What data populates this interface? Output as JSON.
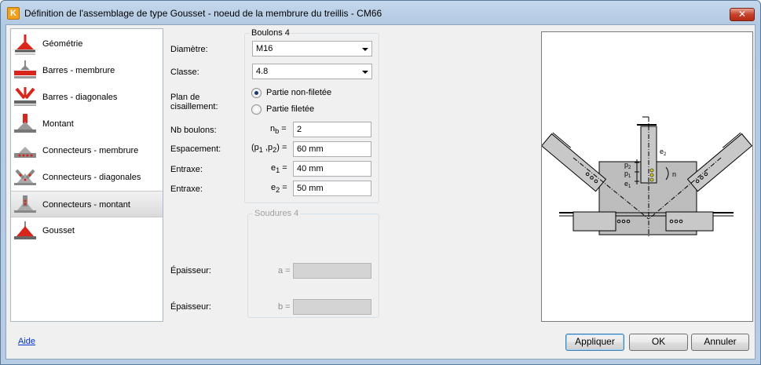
{
  "window": {
    "title": "Définition de l'assemblage de type Gousset - noeud de la membrure du treillis - CM66",
    "close_glyph": "✕",
    "app_icon_glyph": "K"
  },
  "nav": {
    "items": [
      {
        "label": "Géométrie",
        "icon": "geometry-icon"
      },
      {
        "label": "Barres - membrure",
        "icon": "chord-bars-icon"
      },
      {
        "label": "Barres - diagonales",
        "icon": "diagonal-bars-icon"
      },
      {
        "label": "Montant",
        "icon": "vertical-member-icon"
      },
      {
        "label": "Connecteurs - membrure",
        "icon": "chord-connectors-icon"
      },
      {
        "label": "Connecteurs - diagonales",
        "icon": "diagonal-connectors-icon"
      },
      {
        "label": "Connecteurs - montant",
        "icon": "vertical-connectors-icon"
      },
      {
        "label": "Gousset",
        "icon": "gusset-icon"
      }
    ],
    "active_index": 6
  },
  "bolts": {
    "group_title": "Boulons 4",
    "diameter_label": "Diamètre:",
    "diameter_value": "M16",
    "class_label": "Classe:",
    "class_value": "4.8",
    "shear_plane_label_1": "Plan de",
    "shear_plane_label_2": "cisaillement:",
    "shear_options": [
      "Partie non-filetée",
      "Partie filetée"
    ],
    "shear_selected": 0,
    "count_label": "Nb boulons:",
    "count_symbol": "n",
    "count_symbol_sub": "b",
    "count_value": "2",
    "spacing_label": "Espacement:",
    "spacing_symbol": "(p",
    "spacing_symbol_sub1": "1",
    "spacing_symbol_mid": " ,p",
    "spacing_symbol_sub2": "2",
    "spacing_symbol_end": ")",
    "spacing_value": "60 mm",
    "e1_label": "Entraxe:",
    "e1_symbol": "e",
    "e1_symbol_sub": "1",
    "e1_value": "40 mm",
    "e2_label": "Entraxe:",
    "e2_symbol": "e",
    "e2_symbol_sub": "2",
    "e2_value": "50 mm",
    "equals": "="
  },
  "welds": {
    "group_title": "Soudures 4",
    "thickness_a_label": "Épaisseur:",
    "thickness_a_symbol": "a =",
    "thickness_b_label": "Épaisseur:",
    "thickness_b_symbol": "b ="
  },
  "preview": {
    "labels": {
      "e2": "e",
      "e2_sub": "2",
      "p2": "p",
      "p2_sub": "2",
      "p1": "p",
      "p1_sub": "1",
      "e1": "e",
      "e1_sub": "1",
      "n": "n"
    },
    "colors": {
      "steel": "#c8c8c8",
      "gusset": "#bdbdbd",
      "bolt": "#d8d020",
      "line": "#000000"
    }
  },
  "footer": {
    "help_link": "Aide",
    "apply_button": "Appliquer",
    "ok_button": "OK",
    "cancel_button": "Annuler"
  },
  "colors": {
    "accent_red": "#d9261c",
    "link_blue": "#0033cc"
  }
}
